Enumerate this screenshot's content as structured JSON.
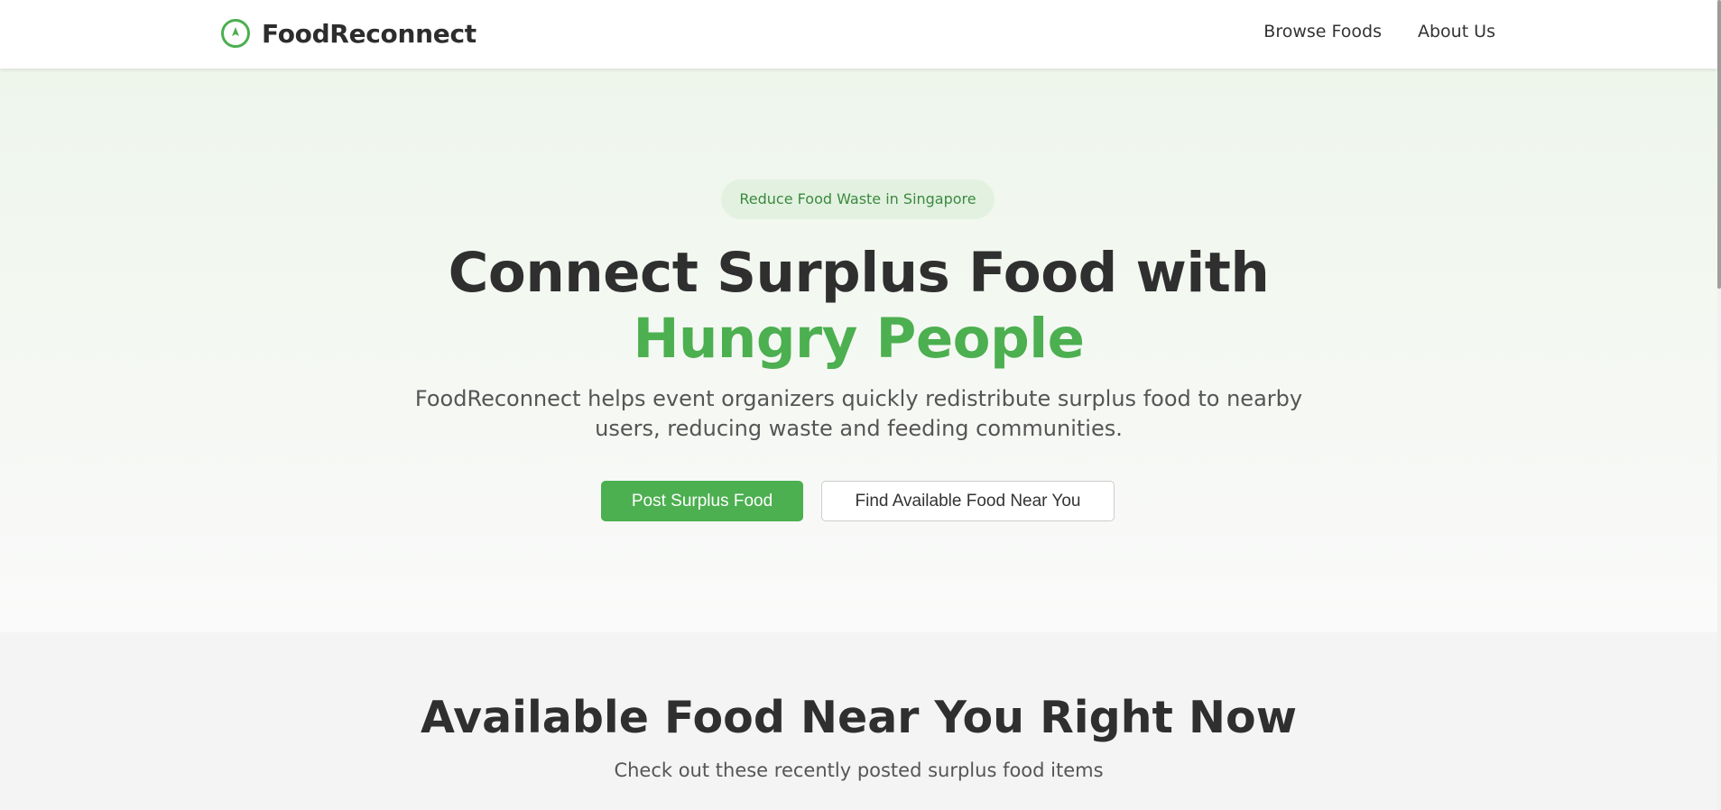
{
  "header": {
    "brand_name": "FoodReconnect",
    "logo_icon": "compass-icon",
    "nav": [
      {
        "label": "Browse Foods"
      },
      {
        "label": "About Us"
      }
    ]
  },
  "hero": {
    "badge": "Reduce Food Waste in Singapore",
    "title_main": "Connect Surplus Food with ",
    "title_accent": "Hungry People",
    "description": "FoodReconnect helps event organizers quickly redistribute surplus food to nearby users, reducing waste and feeding communities.",
    "primary_button": "Post Surplus Food",
    "secondary_button": "Find Available Food Near You"
  },
  "available": {
    "title": "Available Food Near You Right Now",
    "subtitle": "Check out these recently posted surplus food items"
  },
  "colors": {
    "accent": "#4caf50",
    "badge_bg": "#e3f1e1",
    "text_dark": "#2f2f2f",
    "section_bg": "#f4f4f4"
  }
}
